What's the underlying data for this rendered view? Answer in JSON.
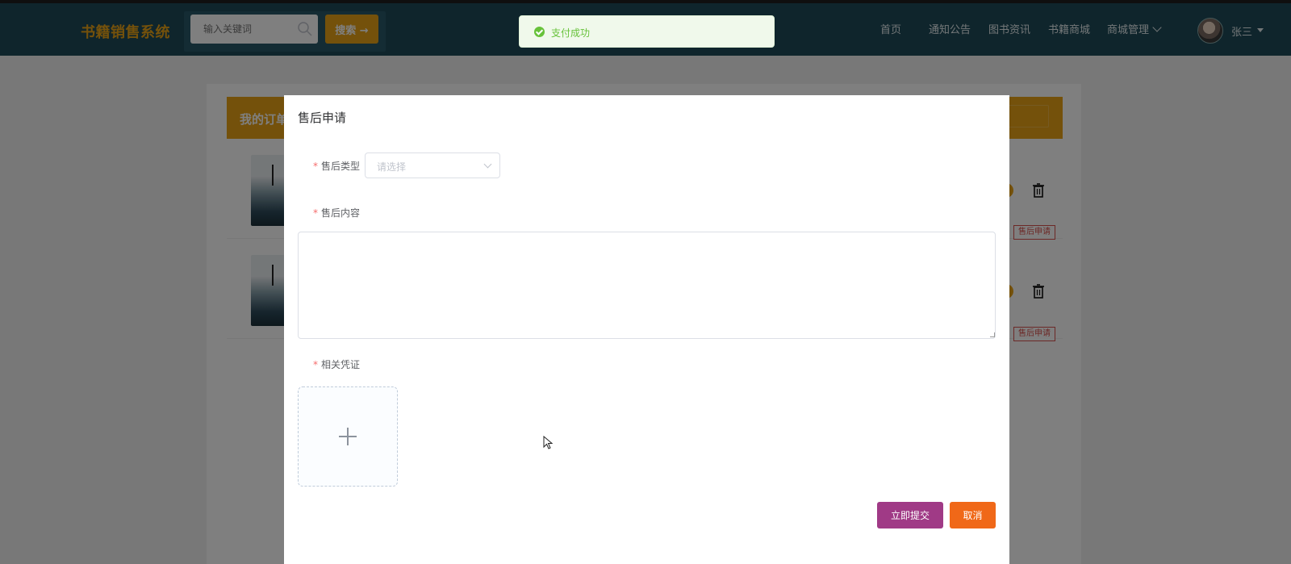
{
  "header": {
    "logo": "书籍销售系统",
    "search": {
      "placeholder": "输入关键词",
      "button_label": "搜索 →"
    },
    "nav": [
      {
        "label": "首页"
      },
      {
        "label": "通知公告"
      },
      {
        "label": "图书资讯"
      },
      {
        "label": "书籍商城"
      },
      {
        "label": "商城管理"
      }
    ],
    "user": {
      "name": "张三"
    }
  },
  "background_page": {
    "orders_title": "我的订单",
    "rows": [
      {
        "after_sale_label": "售后申请"
      },
      {
        "after_sale_label": "售后申请"
      }
    ]
  },
  "toast": {
    "message": "支付成功",
    "type": "success"
  },
  "dialog": {
    "title": "售后申请",
    "type_field": {
      "label": "售后类型",
      "placeholder": "请选择"
    },
    "content_field": {
      "label": "售后内容"
    },
    "evidence_field": {
      "label": "相关凭证"
    },
    "submit_label": "立即提交",
    "cancel_label": "取消"
  },
  "colors": {
    "header_bg": "#1e4a58",
    "accent_orange": "#e8a317",
    "submit_purple": "#a03a86",
    "cancel_orange": "#f06818",
    "success_green": "#67c23a",
    "required_red": "#f56c6c"
  }
}
